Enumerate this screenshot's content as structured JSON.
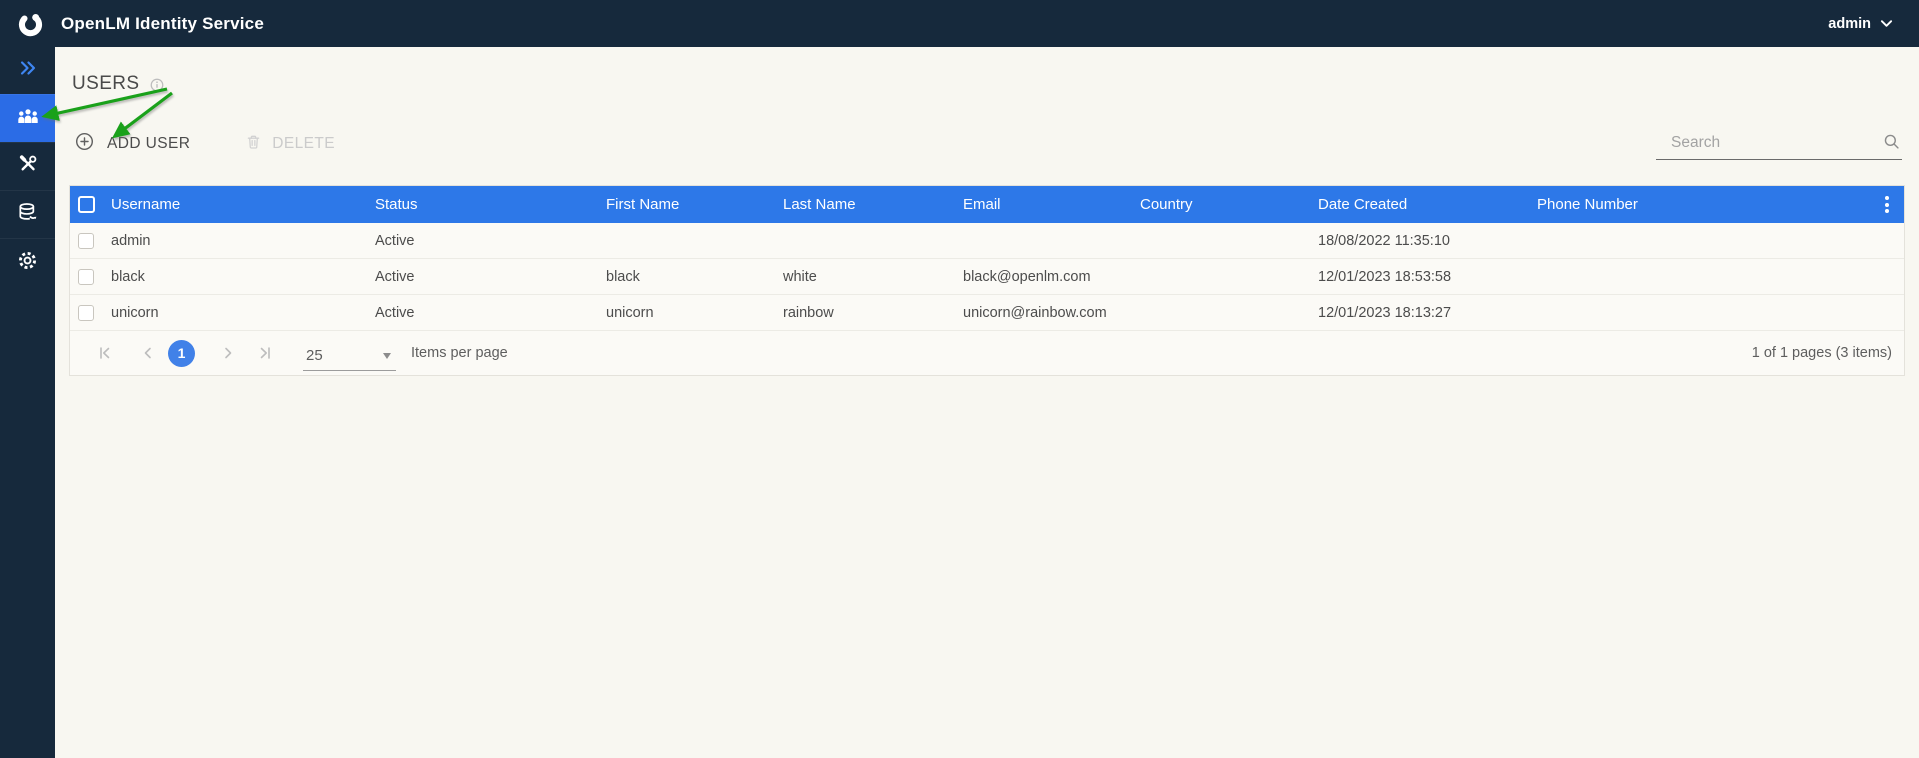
{
  "colors": {
    "topbar_bg": "#16293c",
    "header_blue": "#2d78e8",
    "active_item_blue": "#2b6ce6",
    "page_circle_blue": "#4181e8",
    "annotation_green": "#1aa11a"
  },
  "topbar": {
    "title": "OpenLM Identity Service",
    "user_label": "admin"
  },
  "sidebar": {
    "items": [
      {
        "id": "expand",
        "icon": "double-chevron-right-icon",
        "active": false
      },
      {
        "id": "users",
        "icon": "users-icon",
        "active": true
      },
      {
        "id": "tools",
        "icon": "tools-icon",
        "active": false
      },
      {
        "id": "data",
        "icon": "database-icon",
        "active": false
      },
      {
        "id": "settings",
        "icon": "gear-icon",
        "active": false
      }
    ]
  },
  "page": {
    "title": "USERS"
  },
  "toolbar": {
    "add_user_label": "ADD USER",
    "delete_label": "DELETE",
    "search_placeholder": "Search"
  },
  "table": {
    "columns": [
      "Username",
      "Status",
      "First Name",
      "Last Name",
      "Email",
      "Country",
      "Date Created",
      "Phone Number"
    ],
    "rows": [
      {
        "username": "admin",
        "status": "Active",
        "first_name": "",
        "last_name": "",
        "email": "",
        "country": "",
        "date_created": "18/08/2022 11:35:10",
        "phone_number": ""
      },
      {
        "username": "black",
        "status": "Active",
        "first_name": "black",
        "last_name": "white",
        "email": "black@openlm.com",
        "country": "",
        "date_created": "12/01/2023 18:53:58",
        "phone_number": ""
      },
      {
        "username": "unicorn",
        "status": "Active",
        "first_name": "unicorn",
        "last_name": "rainbow",
        "email": "unicorn@rainbow.com",
        "country": "",
        "date_created": "12/01/2023 18:13:27",
        "phone_number": ""
      }
    ]
  },
  "pagination": {
    "current_page": "1",
    "items_per_page": "25",
    "items_per_page_label": "Items per page",
    "summary": "1 of 1 pages (3 items)"
  }
}
